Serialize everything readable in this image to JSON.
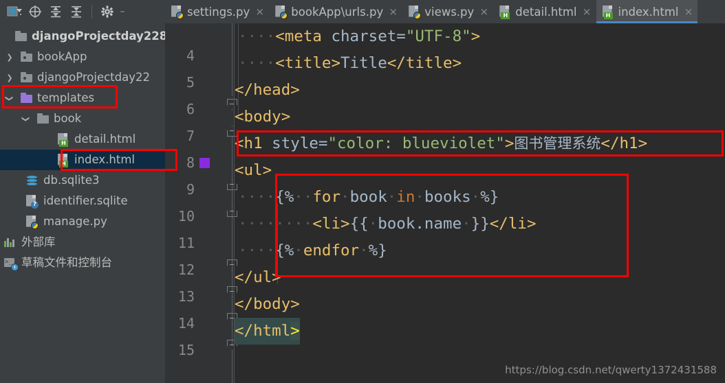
{
  "toolbar": {
    "icons": [
      {
        "name": "run-configurations-icon",
        "glyph": "▣"
      },
      {
        "name": "target-icon",
        "glyph": "⊕"
      },
      {
        "name": "collapse-all-icon",
        "glyph": "⤓"
      },
      {
        "name": "expand-all-icon",
        "glyph": "⤒"
      },
      {
        "name": "settings-gear-icon",
        "glyph": "⚙"
      },
      {
        "name": "hide-icon",
        "glyph": "–"
      }
    ]
  },
  "tabs": [
    {
      "label": "settings.py",
      "type": "python",
      "active": false,
      "close": "×"
    },
    {
      "label": "bookApp\\urls.py",
      "type": "python",
      "active": false,
      "close": "×"
    },
    {
      "label": "views.py",
      "type": "python",
      "active": false,
      "close": "×"
    },
    {
      "label": "detail.html",
      "type": "html",
      "active": false,
      "close": "×"
    },
    {
      "label": "index.html",
      "type": "html",
      "active": true,
      "close": "×"
    }
  ],
  "sidebar": {
    "items": [
      {
        "label": "djangoProjectday228",
        "kind": "root-folder",
        "arrow": "none",
        "indent": 0,
        "bold": true,
        "selected": false
      },
      {
        "label": "bookApp",
        "kind": "module-folder",
        "arrow": "right",
        "indent": 1,
        "bold": false,
        "selected": false
      },
      {
        "label": "djangoProjectday22",
        "kind": "module-folder",
        "arrow": "right",
        "indent": 1,
        "bold": false,
        "selected": false
      },
      {
        "label": "templates",
        "kind": "purple-folder",
        "arrow": "down",
        "indent": 1,
        "bold": false,
        "selected": false
      },
      {
        "label": "book",
        "kind": "folder",
        "arrow": "down",
        "indent": 2,
        "bold": false,
        "selected": false
      },
      {
        "label": "detail.html",
        "kind": "html-file",
        "arrow": "none",
        "indent": 3,
        "bold": false,
        "selected": false
      },
      {
        "label": "index.html",
        "kind": "html-file",
        "arrow": "none",
        "indent": 3,
        "bold": false,
        "selected": true
      },
      {
        "label": "db.sqlite3",
        "kind": "db-file",
        "arrow": "none",
        "indent": 2,
        "bold": false,
        "selected": false
      },
      {
        "label": "identifier.sqlite",
        "kind": "unknown-file",
        "arrow": "none",
        "indent": 2,
        "bold": false,
        "selected": false
      },
      {
        "label": "manage.py",
        "kind": "python-file",
        "arrow": "none",
        "indent": 2,
        "bold": false,
        "selected": false
      },
      {
        "label": "外部库",
        "kind": "library",
        "arrow": "none",
        "indent": 0,
        "bold": false,
        "selected": false
      },
      {
        "label": "草稿文件和控制台",
        "kind": "scratch",
        "arrow": "none",
        "indent": 0,
        "bold": false,
        "selected": false
      }
    ]
  },
  "editor": {
    "color_swatch": "#8a2be2",
    "lines": [
      {
        "num": "4",
        "text": "    <meta charset=\"UTF-8\">"
      },
      {
        "num": "5",
        "text": "    <title>Title</title>"
      },
      {
        "num": "6",
        "text": "</head>"
      },
      {
        "num": "7",
        "text": "<body>"
      },
      {
        "num": "8",
        "text": "<h1 style=\"color: blueviolet\">图书管理系统</h1>"
      },
      {
        "num": "9",
        "text": "<ul>"
      },
      {
        "num": "10",
        "text": "    {%  for book in books %}"
      },
      {
        "num": "11",
        "text": "        <li>{{ book.name }}</li>"
      },
      {
        "num": "12",
        "text": "    {% endfor %}"
      },
      {
        "num": "13",
        "text": "</ul>"
      },
      {
        "num": "14",
        "text": "</body>"
      },
      {
        "num": "15",
        "text": "</html>"
      }
    ],
    "tokens": {
      "meta_tag_open": "<meta",
      "meta_attr": " charset=",
      "meta_str": "\"UTF-8\"",
      "meta_tag_close": ">",
      "title_open": "<title>",
      "title_text": "Title",
      "title_close": "</title>",
      "head_close": "</head>",
      "body_open": "<body>",
      "h1_open": "<h1",
      "h1_attr": " style=",
      "h1_style_value": "\"color: blueviolet\"",
      "h1_gt": ">",
      "h1_text": "图书管理系统",
      "h1_close": "</h1>",
      "ul_open": "<ul>",
      "for_open": "{%",
      "for_kw": "for",
      "for_var": "book",
      "for_in": "in",
      "for_iter": "books",
      "for_close": "%}",
      "li_open": "<li>",
      "expr_open": "{{",
      "expr_var": "book.name",
      "expr_close": "}}",
      "li_close": "</li>",
      "endfor_open": "{%",
      "endfor_kw": "endfor",
      "endfor_close": "%}",
      "ul_close": "</ul>",
      "body_close": "</body>",
      "html_close_text": "</html",
      "html_close_gt": ">"
    }
  },
  "annotations": {
    "watermark": "https://blog.csdn.net/qwerty1372431588",
    "highlight_color": "#ff0000",
    "boxes": [
      "templates-folder",
      "index-html-file",
      "h1-line",
      "for-loop-block"
    ]
  }
}
